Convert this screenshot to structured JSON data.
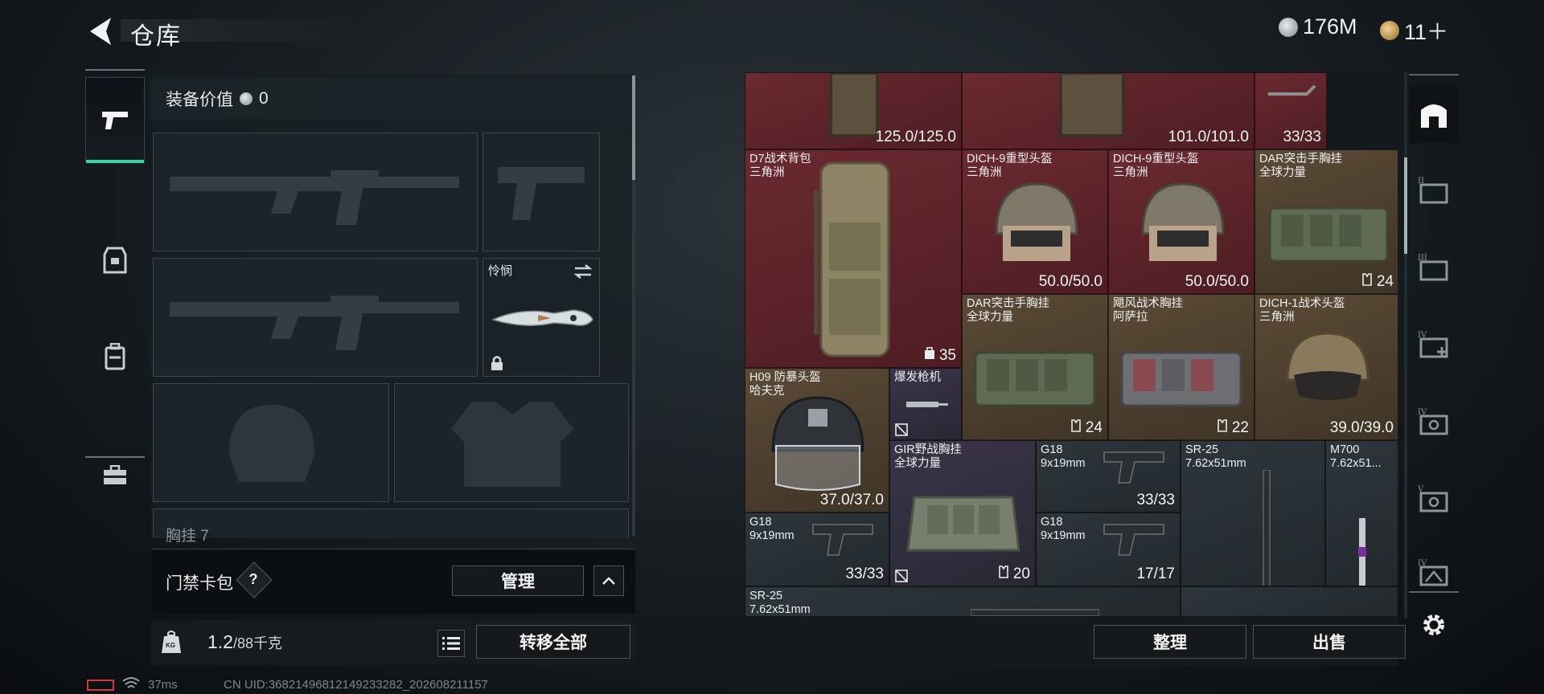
{
  "header": {
    "title": "仓库",
    "currency_1": "176M",
    "currency_2": "11＋"
  },
  "left": {
    "equip_value_label": "装备价值",
    "equip_value": "0",
    "melee_slot_name": "怜悯",
    "cut_label": "胸挂",
    "cut_count": "7",
    "access_card_label": "门禁卡包",
    "access_card_help": "?",
    "manage_label": "管理",
    "weight_current": "1.2",
    "weight_max": "/88千克",
    "weight_icon_text": "KG",
    "transfer_all_label": "转移全部"
  },
  "status": {
    "ping": "37ms",
    "uid": "CN UID:368214968121492332​82_202608211157"
  },
  "stash": {
    "items": [
      {
        "name": "",
        "sub": "",
        "value": "125.0/125.0"
      },
      {
        "name": "",
        "sub": "",
        "value": "101.0/101.0"
      },
      {
        "name": "",
        "sub": "",
        "value": "33/33"
      },
      {
        "name": "D7战术背包",
        "sub": "三角洲",
        "value": "35"
      },
      {
        "name": "DICH-9重型头盔",
        "sub": "三角洲",
        "value": "50.0/50.0"
      },
      {
        "name": "DICH-9重型头盔",
        "sub": "三角洲",
        "value": "50.0/50.0"
      },
      {
        "name": "DAR突击手胸挂",
        "sub": "全球力量",
        "value": "24"
      },
      {
        "name": "DAR突击手胸挂",
        "sub": "全球力量",
        "value": "24"
      },
      {
        "name": "飓风战术胸挂",
        "sub": "阿萨拉",
        "value": "22"
      },
      {
        "name": "DICH-1战术头盔",
        "sub": "三角洲",
        "value": "39.0/39.0"
      },
      {
        "name": "H09 防暴头盔",
        "sub": "哈夫克",
        "value": "37.0/37.0"
      },
      {
        "name": "爆发枪机",
        "sub": "",
        "value": ""
      },
      {
        "name": "GIR野战胸挂",
        "sub": "全球力量",
        "value": "20"
      },
      {
        "name": "G18",
        "sub": "9x19mm",
        "value": "33/33"
      },
      {
        "name": "SR-25",
        "sub": "7.62x51mm",
        "value": ""
      },
      {
        "name": "M700",
        "sub": "7.62x51...",
        "value": ""
      },
      {
        "name": "G18",
        "sub": "9x19mm",
        "value": "33/33"
      },
      {
        "name": "G18",
        "sub": "9x19mm",
        "value": "17/17"
      },
      {
        "name": "SR-25",
        "sub": "7.62x51mm",
        "value": ""
      }
    ],
    "sort_label": "整理",
    "sell_label": "出售"
  },
  "colors": {
    "accent": "#2fd6a8",
    "red_rarity": "#6a2a30",
    "gold_rarity": "#5b4a36",
    "purple_rarity": "#3a3548",
    "gray_rarity": "#2f363b"
  },
  "icons": [
    "back-arrow-icon",
    "silver-coin-icon",
    "gold-coin-icon",
    "pistol-icon",
    "armor-icon",
    "backpack-icon",
    "toolbox-icon",
    "lock-icon",
    "swap-icon",
    "weight-icon",
    "list-icon",
    "chevron-up-icon",
    "stash-main-icon",
    "stash-tab-2-icon",
    "stash-tab-3-icon",
    "stash-tab-4-icon",
    "stash-tab-5-icon",
    "stash-tab-6-icon",
    "stash-tab-7-icon",
    "gear-icon"
  ]
}
